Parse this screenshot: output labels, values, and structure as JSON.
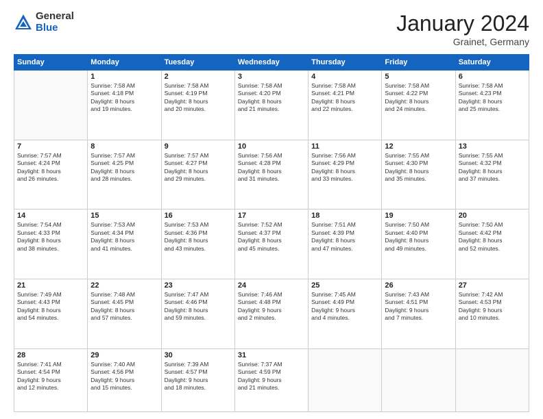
{
  "logo": {
    "general": "General",
    "blue": "Blue"
  },
  "title": {
    "month": "January 2024",
    "location": "Grainet, Germany"
  },
  "weekdays": [
    "Sunday",
    "Monday",
    "Tuesday",
    "Wednesday",
    "Thursday",
    "Friday",
    "Saturday"
  ],
  "weeks": [
    [
      {
        "day": "",
        "info": ""
      },
      {
        "day": "1",
        "info": "Sunrise: 7:58 AM\nSunset: 4:18 PM\nDaylight: 8 hours\nand 19 minutes."
      },
      {
        "day": "2",
        "info": "Sunrise: 7:58 AM\nSunset: 4:19 PM\nDaylight: 8 hours\nand 20 minutes."
      },
      {
        "day": "3",
        "info": "Sunrise: 7:58 AM\nSunset: 4:20 PM\nDaylight: 8 hours\nand 21 minutes."
      },
      {
        "day": "4",
        "info": "Sunrise: 7:58 AM\nSunset: 4:21 PM\nDaylight: 8 hours\nand 22 minutes."
      },
      {
        "day": "5",
        "info": "Sunrise: 7:58 AM\nSunset: 4:22 PM\nDaylight: 8 hours\nand 24 minutes."
      },
      {
        "day": "6",
        "info": "Sunrise: 7:58 AM\nSunset: 4:23 PM\nDaylight: 8 hours\nand 25 minutes."
      }
    ],
    [
      {
        "day": "7",
        "info": "Sunrise: 7:57 AM\nSunset: 4:24 PM\nDaylight: 8 hours\nand 26 minutes."
      },
      {
        "day": "8",
        "info": "Sunrise: 7:57 AM\nSunset: 4:25 PM\nDaylight: 8 hours\nand 28 minutes."
      },
      {
        "day": "9",
        "info": "Sunrise: 7:57 AM\nSunset: 4:27 PM\nDaylight: 8 hours\nand 29 minutes."
      },
      {
        "day": "10",
        "info": "Sunrise: 7:56 AM\nSunset: 4:28 PM\nDaylight: 8 hours\nand 31 minutes."
      },
      {
        "day": "11",
        "info": "Sunrise: 7:56 AM\nSunset: 4:29 PM\nDaylight: 8 hours\nand 33 minutes."
      },
      {
        "day": "12",
        "info": "Sunrise: 7:55 AM\nSunset: 4:30 PM\nDaylight: 8 hours\nand 35 minutes."
      },
      {
        "day": "13",
        "info": "Sunrise: 7:55 AM\nSunset: 4:32 PM\nDaylight: 8 hours\nand 37 minutes."
      }
    ],
    [
      {
        "day": "14",
        "info": "Sunrise: 7:54 AM\nSunset: 4:33 PM\nDaylight: 8 hours\nand 38 minutes."
      },
      {
        "day": "15",
        "info": "Sunrise: 7:53 AM\nSunset: 4:34 PM\nDaylight: 8 hours\nand 41 minutes."
      },
      {
        "day": "16",
        "info": "Sunrise: 7:53 AM\nSunset: 4:36 PM\nDaylight: 8 hours\nand 43 minutes."
      },
      {
        "day": "17",
        "info": "Sunrise: 7:52 AM\nSunset: 4:37 PM\nDaylight: 8 hours\nand 45 minutes."
      },
      {
        "day": "18",
        "info": "Sunrise: 7:51 AM\nSunset: 4:39 PM\nDaylight: 8 hours\nand 47 minutes."
      },
      {
        "day": "19",
        "info": "Sunrise: 7:50 AM\nSunset: 4:40 PM\nDaylight: 8 hours\nand 49 minutes."
      },
      {
        "day": "20",
        "info": "Sunrise: 7:50 AM\nSunset: 4:42 PM\nDaylight: 8 hours\nand 52 minutes."
      }
    ],
    [
      {
        "day": "21",
        "info": "Sunrise: 7:49 AM\nSunset: 4:43 PM\nDaylight: 8 hours\nand 54 minutes."
      },
      {
        "day": "22",
        "info": "Sunrise: 7:48 AM\nSunset: 4:45 PM\nDaylight: 8 hours\nand 57 minutes."
      },
      {
        "day": "23",
        "info": "Sunrise: 7:47 AM\nSunset: 4:46 PM\nDaylight: 8 hours\nand 59 minutes."
      },
      {
        "day": "24",
        "info": "Sunrise: 7:46 AM\nSunset: 4:48 PM\nDaylight: 9 hours\nand 2 minutes."
      },
      {
        "day": "25",
        "info": "Sunrise: 7:45 AM\nSunset: 4:49 PM\nDaylight: 9 hours\nand 4 minutes."
      },
      {
        "day": "26",
        "info": "Sunrise: 7:43 AM\nSunset: 4:51 PM\nDaylight: 9 hours\nand 7 minutes."
      },
      {
        "day": "27",
        "info": "Sunrise: 7:42 AM\nSunset: 4:53 PM\nDaylight: 9 hours\nand 10 minutes."
      }
    ],
    [
      {
        "day": "28",
        "info": "Sunrise: 7:41 AM\nSunset: 4:54 PM\nDaylight: 9 hours\nand 12 minutes."
      },
      {
        "day": "29",
        "info": "Sunrise: 7:40 AM\nSunset: 4:56 PM\nDaylight: 9 hours\nand 15 minutes."
      },
      {
        "day": "30",
        "info": "Sunrise: 7:39 AM\nSunset: 4:57 PM\nDaylight: 9 hours\nand 18 minutes."
      },
      {
        "day": "31",
        "info": "Sunrise: 7:37 AM\nSunset: 4:59 PM\nDaylight: 9 hours\nand 21 minutes."
      },
      {
        "day": "",
        "info": ""
      },
      {
        "day": "",
        "info": ""
      },
      {
        "day": "",
        "info": ""
      }
    ]
  ]
}
